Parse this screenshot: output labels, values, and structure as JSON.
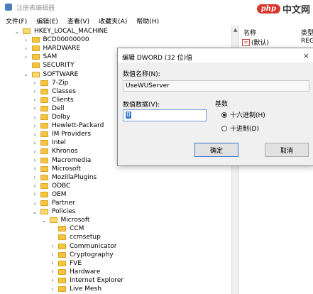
{
  "window": {
    "title": "注册表编辑器"
  },
  "watermark": {
    "badge": "php",
    "text": "中文网"
  },
  "menu": [
    "文件(F)",
    "编辑(E)",
    "查看(V)",
    "收藏夹(A)",
    "帮助(H)"
  ],
  "tree": [
    {
      "label": "HKEY_LOCAL_MACHINE",
      "depth": 0,
      "expanded": true
    },
    {
      "label": "BCD00000000",
      "depth": 1,
      "expanded": false
    },
    {
      "label": "HARDWARE",
      "depth": 1,
      "expanded": false
    },
    {
      "label": "SAM",
      "depth": 1,
      "expanded": false
    },
    {
      "label": "SECURITY",
      "depth": 1,
      "expanded": null
    },
    {
      "label": "SOFTWARE",
      "depth": 1,
      "expanded": true
    },
    {
      "label": "7-Zip",
      "depth": 2,
      "expanded": false
    },
    {
      "label": "Classes",
      "depth": 2,
      "expanded": false
    },
    {
      "label": "Clients",
      "depth": 2,
      "expanded": false
    },
    {
      "label": "Dell",
      "depth": 2,
      "expanded": false
    },
    {
      "label": "Dolby",
      "depth": 2,
      "expanded": false
    },
    {
      "label": "Hewlett-Packard",
      "depth": 2,
      "expanded": false
    },
    {
      "label": "IM Providers",
      "depth": 2,
      "expanded": false
    },
    {
      "label": "Intel",
      "depth": 2,
      "expanded": false
    },
    {
      "label": "Khronos",
      "depth": 2,
      "expanded": false
    },
    {
      "label": "Macromedia",
      "depth": 2,
      "expanded": false
    },
    {
      "label": "Microsoft",
      "depth": 2,
      "expanded": false
    },
    {
      "label": "MozillaPlugins",
      "depth": 2,
      "expanded": false
    },
    {
      "label": "ODBC",
      "depth": 2,
      "expanded": false
    },
    {
      "label": "OEM",
      "depth": 2,
      "expanded": false
    },
    {
      "label": "Partner",
      "depth": 2,
      "expanded": false
    },
    {
      "label": "Policies",
      "depth": 2,
      "expanded": true
    },
    {
      "label": "Microsoft",
      "depth": 3,
      "expanded": true
    },
    {
      "label": "CCM",
      "depth": 4,
      "expanded": null
    },
    {
      "label": "ccmsetup",
      "depth": 4,
      "expanded": null
    },
    {
      "label": "Communicator",
      "depth": 4,
      "expanded": false
    },
    {
      "label": "Cryptography",
      "depth": 4,
      "expanded": false
    },
    {
      "label": "FVE",
      "depth": 4,
      "expanded": false
    },
    {
      "label": "Hardware",
      "depth": 4,
      "expanded": false
    },
    {
      "label": "Internet Explorer",
      "depth": 4,
      "expanded": false
    },
    {
      "label": "Live Mesh",
      "depth": 4,
      "expanded": false
    }
  ],
  "right_pane": {
    "col_name": "名称",
    "col_type": "类型",
    "row_name": "(默认)",
    "row_type": "REG"
  },
  "dialog": {
    "title": "编辑 DWORD (32 位)值",
    "close": "×",
    "value_name_label": "数值名称(N):",
    "value_name": "UseWUServer",
    "value_data_label": "数值数据(V):",
    "value_data": "0",
    "base_label": "基数",
    "radio_hex": "十六进制(H)",
    "radio_dec": "十进制(D)",
    "selected_base": "hex",
    "ok": "确定",
    "cancel": "取消"
  },
  "icons": {
    "app": "registry-editor-icon",
    "expanded": "chevron-down-icon",
    "collapsed": "chevron-right-icon",
    "folder": "folder-icon",
    "string_value": "string-value-icon"
  },
  "colors": {
    "folder": "#f4c542",
    "accent": "#3a78d6",
    "dialog_body": "#f0f0f0"
  }
}
